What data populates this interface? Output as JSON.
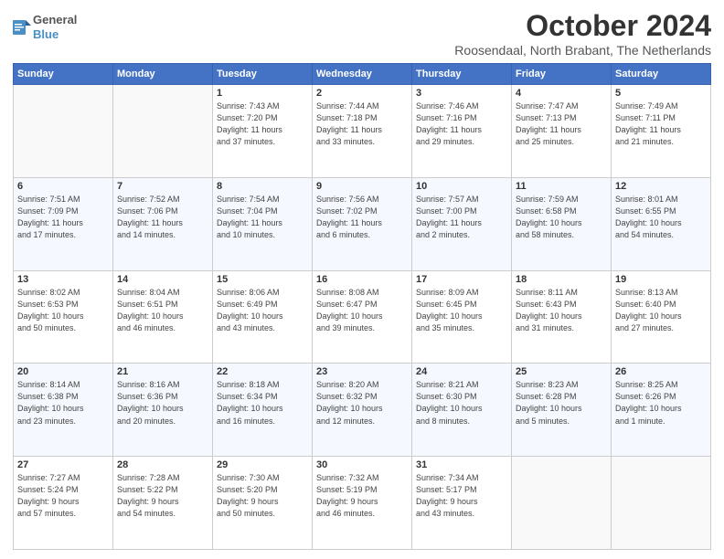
{
  "logo": {
    "line1": "General",
    "line2": "Blue"
  },
  "title": "October 2024",
  "subtitle": "Roosendaal, North Brabant, The Netherlands",
  "days_header": [
    "Sunday",
    "Monday",
    "Tuesday",
    "Wednesday",
    "Thursday",
    "Friday",
    "Saturday"
  ],
  "weeks": [
    [
      {
        "day": "",
        "info": ""
      },
      {
        "day": "",
        "info": ""
      },
      {
        "day": "1",
        "info": "Sunrise: 7:43 AM\nSunset: 7:20 PM\nDaylight: 11 hours\nand 37 minutes."
      },
      {
        "day": "2",
        "info": "Sunrise: 7:44 AM\nSunset: 7:18 PM\nDaylight: 11 hours\nand 33 minutes."
      },
      {
        "day": "3",
        "info": "Sunrise: 7:46 AM\nSunset: 7:16 PM\nDaylight: 11 hours\nand 29 minutes."
      },
      {
        "day": "4",
        "info": "Sunrise: 7:47 AM\nSunset: 7:13 PM\nDaylight: 11 hours\nand 25 minutes."
      },
      {
        "day": "5",
        "info": "Sunrise: 7:49 AM\nSunset: 7:11 PM\nDaylight: 11 hours\nand 21 minutes."
      }
    ],
    [
      {
        "day": "6",
        "info": "Sunrise: 7:51 AM\nSunset: 7:09 PM\nDaylight: 11 hours\nand 17 minutes."
      },
      {
        "day": "7",
        "info": "Sunrise: 7:52 AM\nSunset: 7:06 PM\nDaylight: 11 hours\nand 14 minutes."
      },
      {
        "day": "8",
        "info": "Sunrise: 7:54 AM\nSunset: 7:04 PM\nDaylight: 11 hours\nand 10 minutes."
      },
      {
        "day": "9",
        "info": "Sunrise: 7:56 AM\nSunset: 7:02 PM\nDaylight: 11 hours\nand 6 minutes."
      },
      {
        "day": "10",
        "info": "Sunrise: 7:57 AM\nSunset: 7:00 PM\nDaylight: 11 hours\nand 2 minutes."
      },
      {
        "day": "11",
        "info": "Sunrise: 7:59 AM\nSunset: 6:58 PM\nDaylight: 10 hours\nand 58 minutes."
      },
      {
        "day": "12",
        "info": "Sunrise: 8:01 AM\nSunset: 6:55 PM\nDaylight: 10 hours\nand 54 minutes."
      }
    ],
    [
      {
        "day": "13",
        "info": "Sunrise: 8:02 AM\nSunset: 6:53 PM\nDaylight: 10 hours\nand 50 minutes."
      },
      {
        "day": "14",
        "info": "Sunrise: 8:04 AM\nSunset: 6:51 PM\nDaylight: 10 hours\nand 46 minutes."
      },
      {
        "day": "15",
        "info": "Sunrise: 8:06 AM\nSunset: 6:49 PM\nDaylight: 10 hours\nand 43 minutes."
      },
      {
        "day": "16",
        "info": "Sunrise: 8:08 AM\nSunset: 6:47 PM\nDaylight: 10 hours\nand 39 minutes."
      },
      {
        "day": "17",
        "info": "Sunrise: 8:09 AM\nSunset: 6:45 PM\nDaylight: 10 hours\nand 35 minutes."
      },
      {
        "day": "18",
        "info": "Sunrise: 8:11 AM\nSunset: 6:43 PM\nDaylight: 10 hours\nand 31 minutes."
      },
      {
        "day": "19",
        "info": "Sunrise: 8:13 AM\nSunset: 6:40 PM\nDaylight: 10 hours\nand 27 minutes."
      }
    ],
    [
      {
        "day": "20",
        "info": "Sunrise: 8:14 AM\nSunset: 6:38 PM\nDaylight: 10 hours\nand 23 minutes."
      },
      {
        "day": "21",
        "info": "Sunrise: 8:16 AM\nSunset: 6:36 PM\nDaylight: 10 hours\nand 20 minutes."
      },
      {
        "day": "22",
        "info": "Sunrise: 8:18 AM\nSunset: 6:34 PM\nDaylight: 10 hours\nand 16 minutes."
      },
      {
        "day": "23",
        "info": "Sunrise: 8:20 AM\nSunset: 6:32 PM\nDaylight: 10 hours\nand 12 minutes."
      },
      {
        "day": "24",
        "info": "Sunrise: 8:21 AM\nSunset: 6:30 PM\nDaylight: 10 hours\nand 8 minutes."
      },
      {
        "day": "25",
        "info": "Sunrise: 8:23 AM\nSunset: 6:28 PM\nDaylight: 10 hours\nand 5 minutes."
      },
      {
        "day": "26",
        "info": "Sunrise: 8:25 AM\nSunset: 6:26 PM\nDaylight: 10 hours\nand 1 minute."
      }
    ],
    [
      {
        "day": "27",
        "info": "Sunrise: 7:27 AM\nSunset: 5:24 PM\nDaylight: 9 hours\nand 57 minutes."
      },
      {
        "day": "28",
        "info": "Sunrise: 7:28 AM\nSunset: 5:22 PM\nDaylight: 9 hours\nand 54 minutes."
      },
      {
        "day": "29",
        "info": "Sunrise: 7:30 AM\nSunset: 5:20 PM\nDaylight: 9 hours\nand 50 minutes."
      },
      {
        "day": "30",
        "info": "Sunrise: 7:32 AM\nSunset: 5:19 PM\nDaylight: 9 hours\nand 46 minutes."
      },
      {
        "day": "31",
        "info": "Sunrise: 7:34 AM\nSunset: 5:17 PM\nDaylight: 9 hours\nand 43 minutes."
      },
      {
        "day": "",
        "info": ""
      },
      {
        "day": "",
        "info": ""
      }
    ]
  ]
}
